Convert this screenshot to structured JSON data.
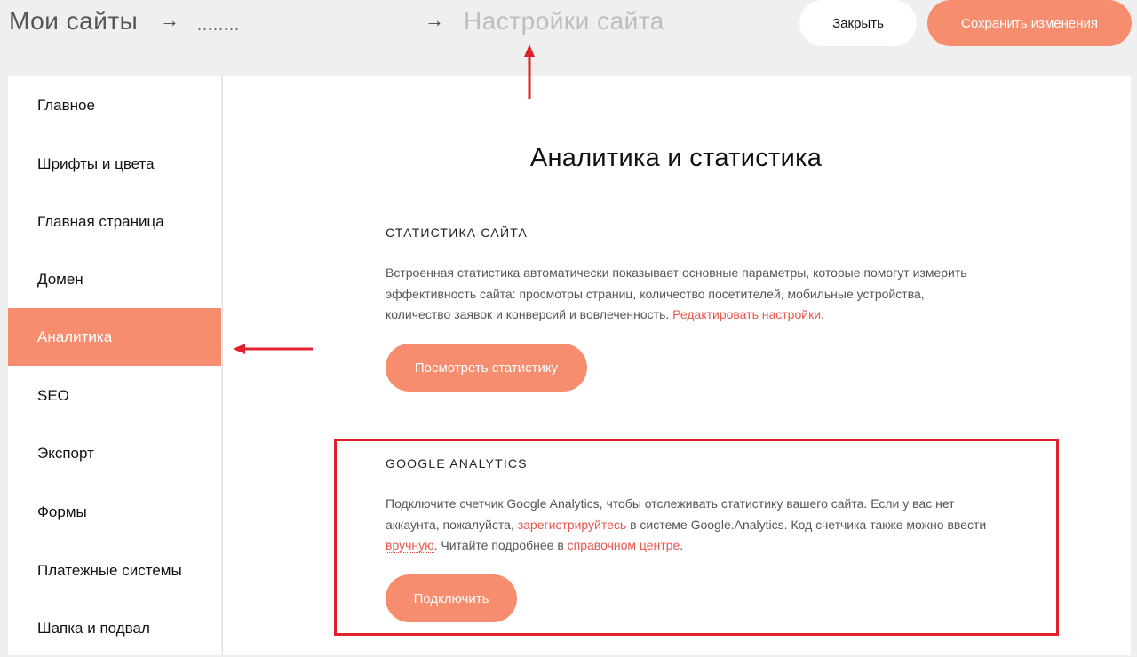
{
  "header": {
    "root_crumb": "Мои сайты",
    "arrow1": "→",
    "site_name_placeholder": "........",
    "arrow2": "→",
    "current_crumb": "Настройки сайта",
    "close_label": "Закрыть",
    "save_label": "Сохранить изменения"
  },
  "sidebar": {
    "items": [
      {
        "label": "Главное"
      },
      {
        "label": "Шрифты и цвета"
      },
      {
        "label": "Главная страница"
      },
      {
        "label": "Домен"
      },
      {
        "label": "Аналитика",
        "active": true
      },
      {
        "label": "SEO"
      },
      {
        "label": "Экспорт"
      },
      {
        "label": "Формы"
      },
      {
        "label": "Платежные системы"
      },
      {
        "label": "Шапка и подвал"
      }
    ]
  },
  "main": {
    "title": "Аналитика и статистика",
    "stats": {
      "heading": "СТАТИСТИКА САЙТА",
      "text": "Встроенная статистика автоматически показывает основные параметры, которые помогут измерить эффективность сайта: просмотры страниц, количество посетителей, мобильные устройства, количество заявок и конверсий и вовлеченность.",
      "link": "Редактировать настройки",
      "link_tail": ".",
      "button": "Посмотреть статистику"
    },
    "ga": {
      "heading": "GOOGLE ANALYTICS",
      "text_part1": "Подключите счетчик Google Analytics, чтобы отслеживать статистику вашего сайта. Если у вас нет аккаунта, пожалуйста, ",
      "link_register": "зарегистрируйтесь",
      "text_part2": " в системе Google.Analytics. Код счетчика также можно ввести ",
      "link_manual": "вручную",
      "text_part3": ". Читайте подробнее в ",
      "link_help": "справочном центре",
      "text_part4": ".",
      "button": "Подключить"
    }
  },
  "colors": {
    "accent": "#f68d6e",
    "link": "#e8574b",
    "annotation": "#e0202b",
    "background": "#efefef"
  }
}
